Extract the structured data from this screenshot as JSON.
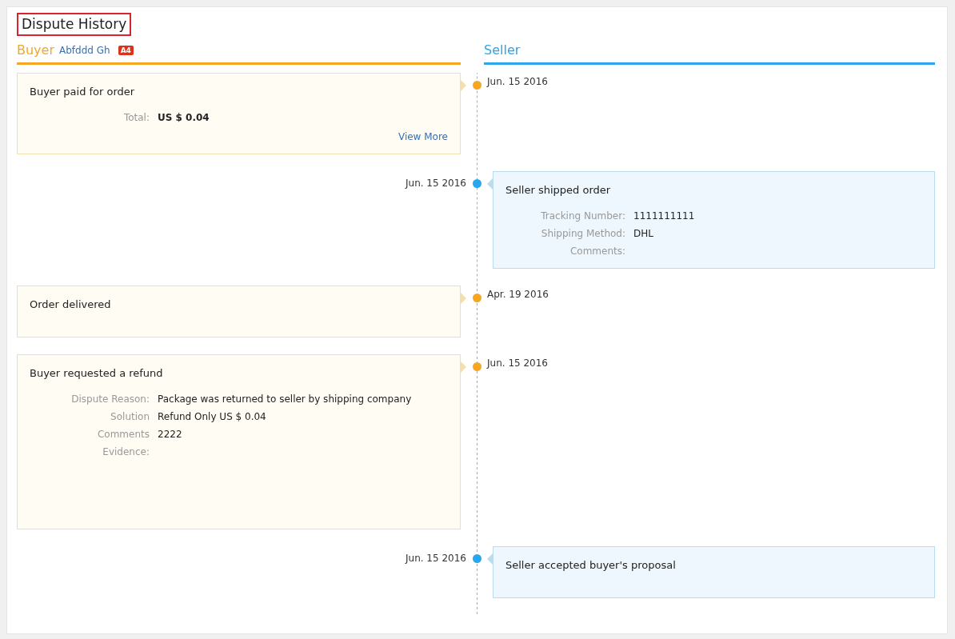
{
  "title": "Dispute History",
  "buyer_header": {
    "label": "Buyer",
    "name": "Abfddd Gh",
    "badge": "A4"
  },
  "seller_header": {
    "label": "Seller"
  },
  "events": [
    {
      "kind": "buyer",
      "date": "Jun. 15 2016",
      "title": "Buyer paid for order",
      "fields": [
        {
          "label": "Total:",
          "value": "US $ 0.04",
          "strong": true
        }
      ],
      "link": "View More"
    },
    {
      "kind": "seller",
      "date": "Jun. 15 2016",
      "title": "Seller shipped order",
      "fields": [
        {
          "label": "Tracking Number:",
          "value": "1111111111"
        },
        {
          "label": "Shipping Method:",
          "value": "DHL"
        },
        {
          "label": "Comments:"
        }
      ]
    },
    {
      "kind": "buyer",
      "date": "Apr. 19 2016",
      "title": "Order delivered"
    },
    {
      "kind": "buyer",
      "date": "Jun. 15 2016",
      "title": "Buyer requested a refund",
      "fields": [
        {
          "label": "Dispute Reason:",
          "value": "Package was returned to seller by shipping company"
        },
        {
          "label": "Solution",
          "value": "Refund Only US $ 0.04"
        },
        {
          "label": "Comments",
          "value": "2222"
        },
        {
          "label": "Evidence:"
        }
      ],
      "tall": true
    },
    {
      "kind": "seller",
      "date": "Jun. 15 2016",
      "title": "Seller accepted buyer's proposal"
    }
  ]
}
